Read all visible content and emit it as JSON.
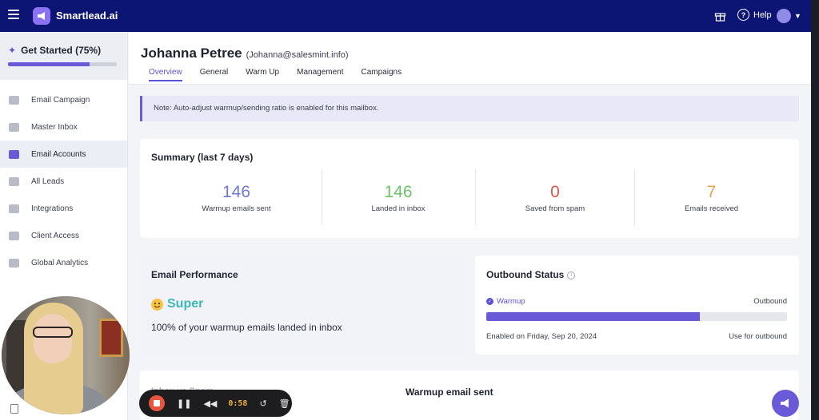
{
  "app": {
    "brand": "Smartlead.ai",
    "help_label": "Help"
  },
  "sidebar": {
    "get_started": {
      "label": "Get Started (75%)",
      "progress": 0.75
    },
    "items": [
      {
        "label": "Email Campaign",
        "icon": "megaphone-icon"
      },
      {
        "label": "Master Inbox",
        "icon": "inbox-icon"
      },
      {
        "label": "Email Accounts",
        "icon": "mail-icon",
        "active": true
      },
      {
        "label": "All Leads",
        "icon": "leads-icon"
      },
      {
        "label": "Integrations",
        "icon": "puzzle-icon"
      },
      {
        "label": "Client Access",
        "icon": "bolt-icon"
      },
      {
        "label": "Global Analytics",
        "icon": "chart-icon"
      }
    ]
  },
  "account": {
    "name": "Johanna Petree",
    "email": "(Johanna@salesmint.info)"
  },
  "tabs": [
    "Overview",
    "General",
    "Warm Up",
    "Management",
    "Campaigns"
  ],
  "active_tab": "Overview",
  "note": "Note: Auto-adjust warmup/sending ratio is enabled for this mailbox.",
  "summary": {
    "title": "Summary (last 7 days)",
    "stats": [
      {
        "value": "146",
        "label": "Warmup emails sent",
        "color": "#6f79d6"
      },
      {
        "value": "146",
        "label": "Landed in inbox",
        "color": "#6cc26a"
      },
      {
        "value": "0",
        "label": "Saved from spam",
        "color": "#e0554b"
      },
      {
        "value": "7",
        "label": "Emails received",
        "color": "#e8a24c"
      }
    ]
  },
  "performance": {
    "title": "Email Performance",
    "rating": "Super",
    "text": "100% of your warmup emails landed in inbox"
  },
  "outbound": {
    "title": "Outbound Status",
    "left_label": "Warmup",
    "right_label": "Outbound",
    "warmup_fraction": 0.71,
    "enabled_text": "Enabled on Friday, Sep 20, 2024",
    "use_label": "Use for outbound"
  },
  "bottom": {
    "left_title": "Inbox vs Spam",
    "center_title": "Warmup email sent"
  },
  "recorder": {
    "time": "0:58"
  },
  "colors": {
    "topbar": "#0c1573",
    "accent": "#6a5ad8"
  }
}
